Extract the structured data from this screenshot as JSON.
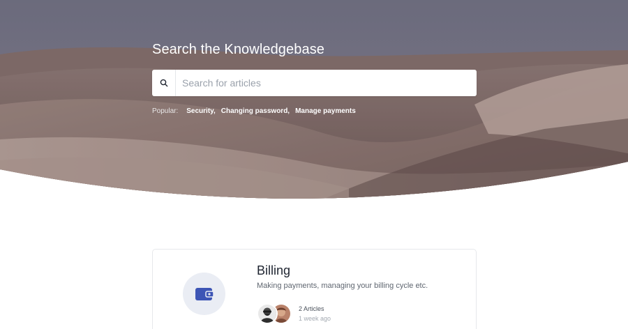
{
  "hero": {
    "title": "Search the Knowledgebase",
    "search_placeholder": "Search for articles",
    "popular_label": "Popular:",
    "popular_links": [
      "Security,",
      "Changing password,",
      "Manage payments"
    ]
  },
  "card": {
    "title": "Billing",
    "description": "Making payments, managing your billing cycle etc.",
    "articles_count": "2 Articles",
    "updated": "1 week ago",
    "icon": "wallet-icon"
  },
  "colors": {
    "sky": "#6f6f7f",
    "dune_dark": "#6f5a55",
    "dune_light": "#a58f86",
    "accent_blue": "#3d55b5",
    "icon_bg": "#eaedf4"
  }
}
